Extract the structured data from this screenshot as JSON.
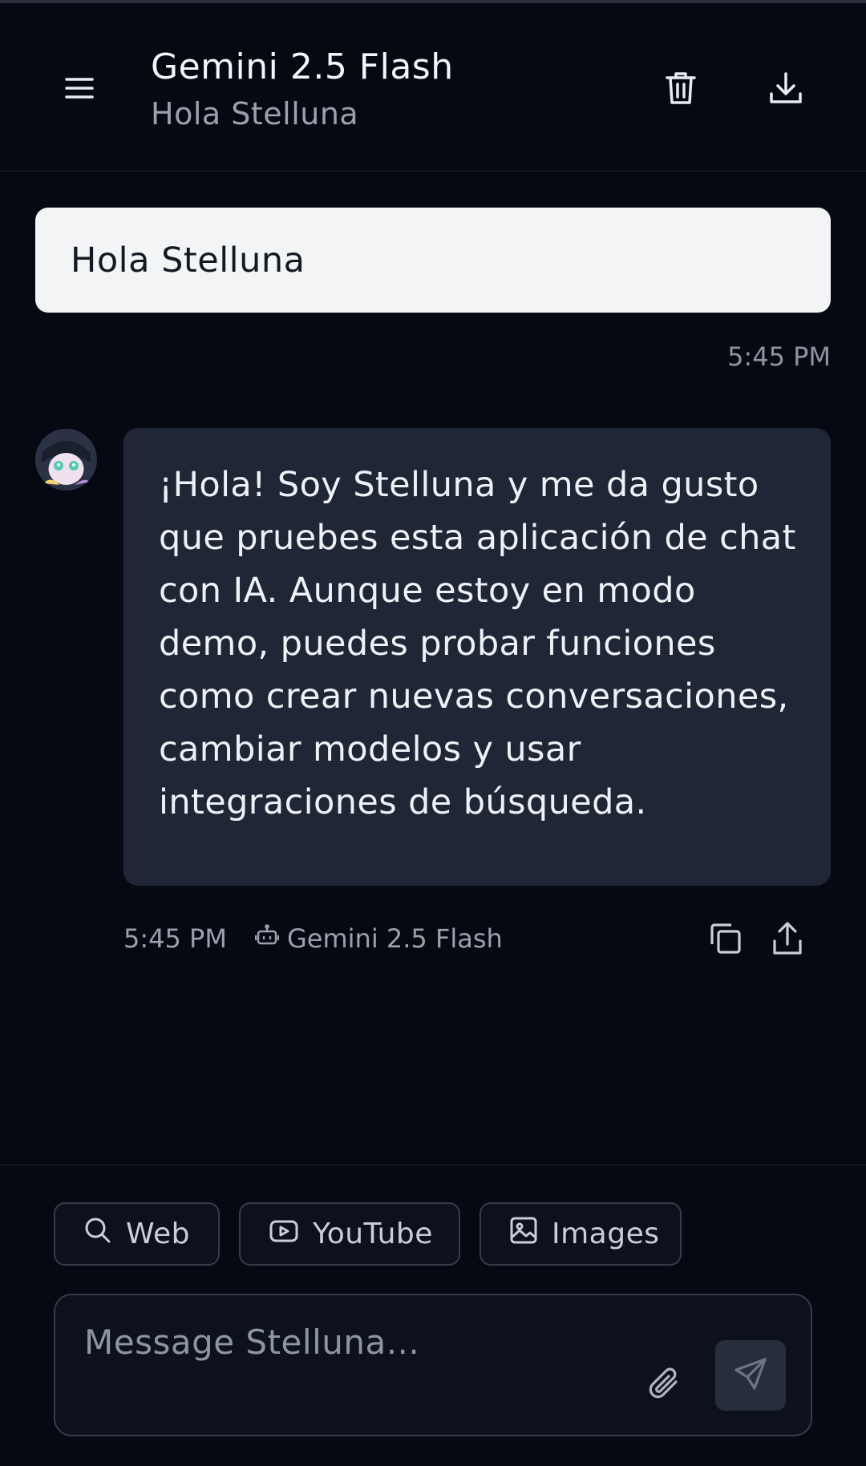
{
  "header": {
    "title": "Gemini 2.5 Flash",
    "subtitle": "Hola Stelluna",
    "icons": {
      "menu": "menu-icon",
      "trash": "trash-icon",
      "download": "download-icon"
    }
  },
  "messages": {
    "user": {
      "text": "Hola Stelluna",
      "time": "5:45 PM"
    },
    "assistant": {
      "avatar": "stelluna-avatar",
      "text": "¡Hola! Soy Stelluna y me da gusto que pruebes esta aplicación de chat con IA. Aunque estoy en modo demo, puedes probar funciones como crear nuevas conversaciones, cambiar modelos y usar integraciones de búsqueda.",
      "time": "5:45 PM",
      "model": "Gemini 2.5 Flash",
      "icons": {
        "model": "bot-icon",
        "copy": "copy-icon",
        "share": "share-icon"
      }
    }
  },
  "composer": {
    "chips": [
      {
        "label": "Web",
        "icon": "search-icon"
      },
      {
        "label": "YouTube",
        "icon": "youtube-icon"
      },
      {
        "label": "Images",
        "icon": "image-icon"
      }
    ],
    "placeholder": "Message Stelluna...",
    "value": "",
    "icons": {
      "attach": "paperclip-icon",
      "send": "send-icon"
    }
  },
  "colors": {
    "background": "#060912",
    "user_bubble": "#f3f4f6",
    "assistant_bubble": "#1f2736",
    "muted_text": "#9aa1ad",
    "border": "#343b49"
  }
}
